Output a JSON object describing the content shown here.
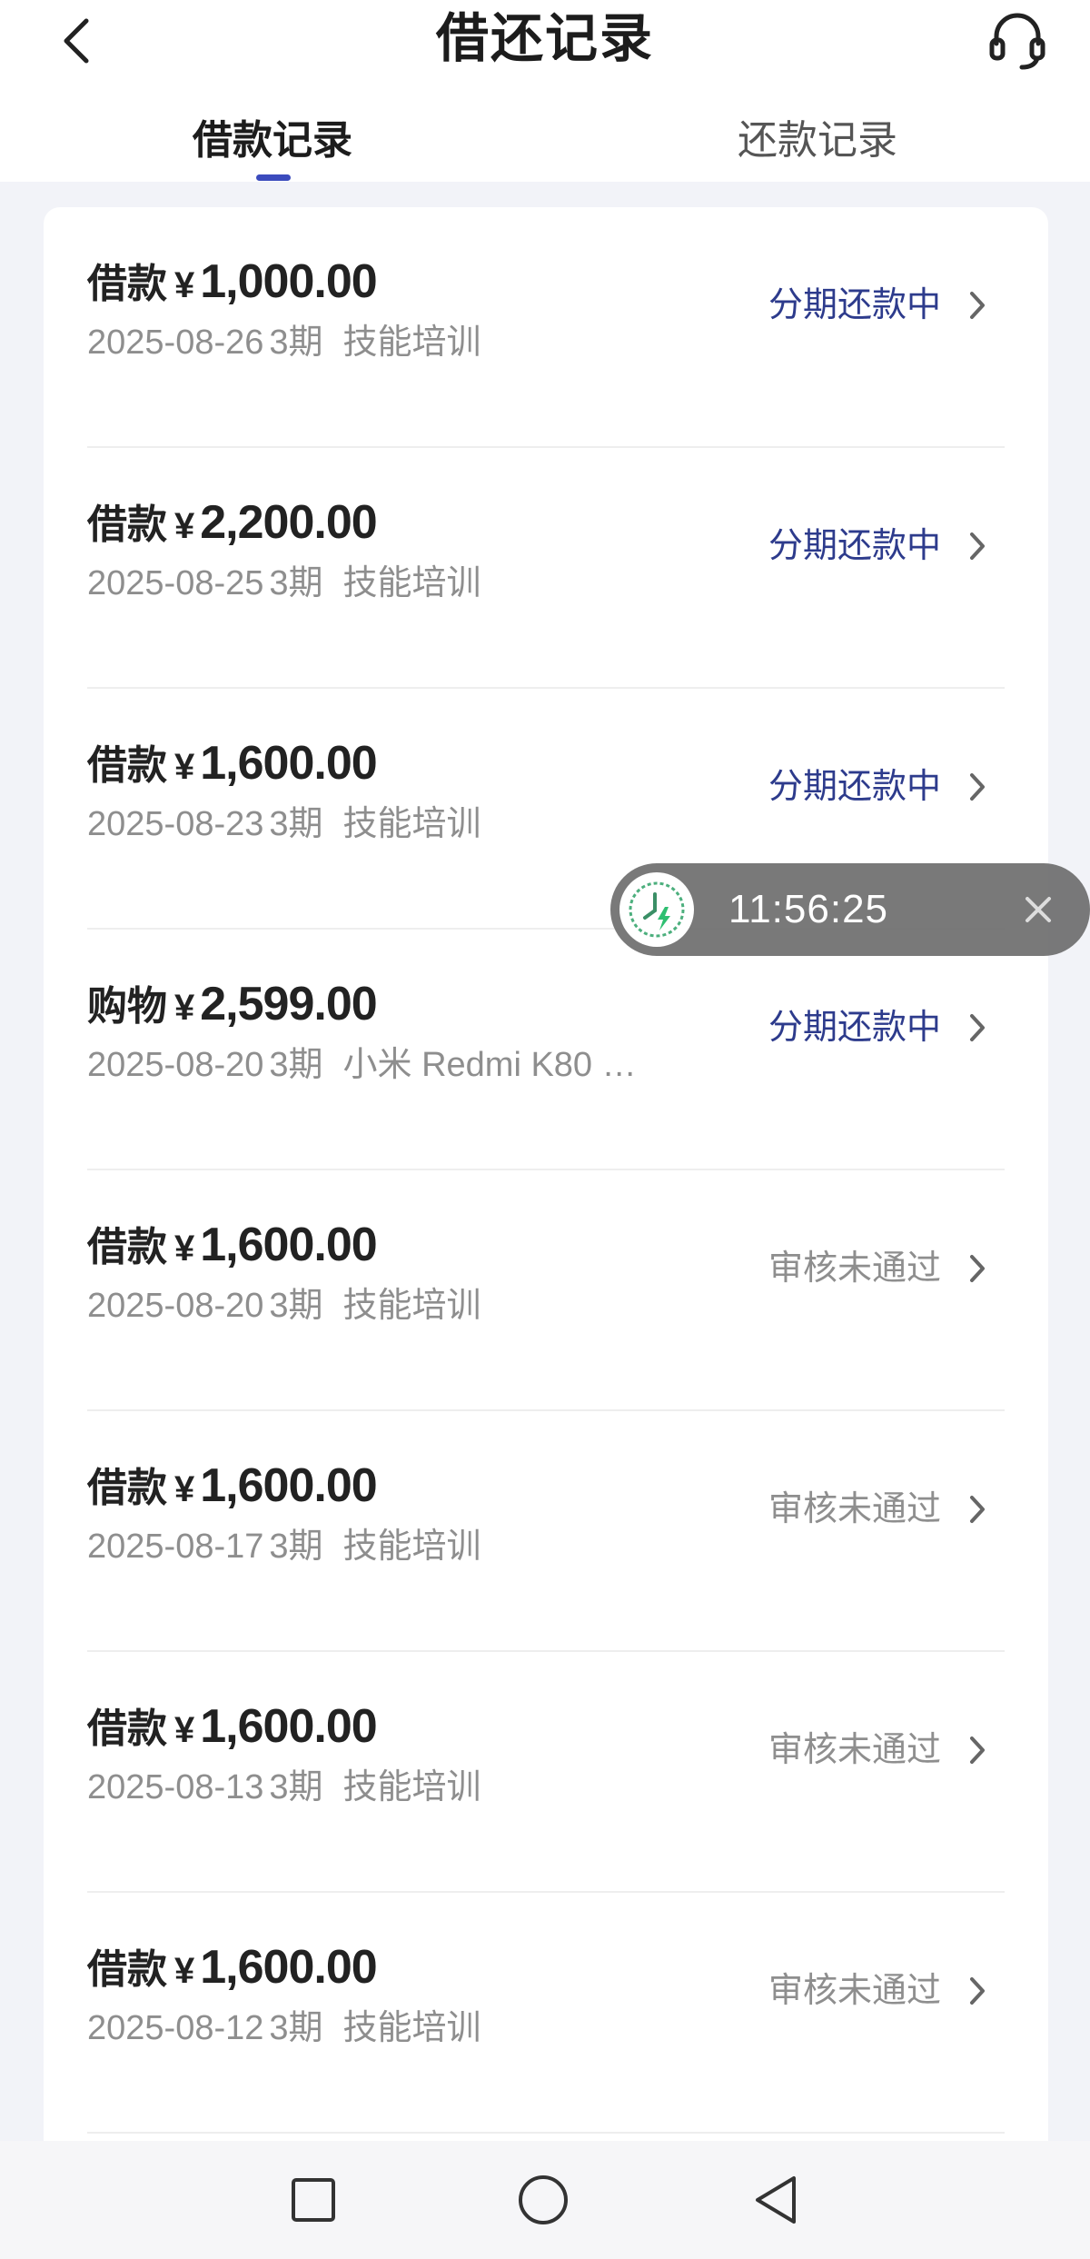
{
  "header": {
    "title": "借还记录",
    "back_icon": "chevron-left-icon",
    "support_icon": "headset-icon"
  },
  "tabs": [
    {
      "label": "借款记录",
      "active": true
    },
    {
      "label": "还款记录",
      "active": false
    }
  ],
  "colors": {
    "accent": "#3b4bbd",
    "status_active": "#2d3b8c",
    "status_rejected": "#8e8e8e",
    "page_bg": "#f2f3f8"
  },
  "records": [
    {
      "kind": "借款",
      "currency": "¥",
      "amount": "1,000.00",
      "date": "2025-08-26",
      "term": "3期",
      "desc": "技能培训",
      "status": "分期还款中",
      "status_type": "active"
    },
    {
      "kind": "借款",
      "currency": "¥",
      "amount": "2,200.00",
      "date": "2025-08-25",
      "term": "3期",
      "desc": "技能培训",
      "status": "分期还款中",
      "status_type": "active"
    },
    {
      "kind": "借款",
      "currency": "¥",
      "amount": "1,600.00",
      "date": "2025-08-23",
      "term": "3期",
      "desc": "技能培训",
      "status": "分期还款中",
      "status_type": "active"
    },
    {
      "kind": "购物",
      "currency": "¥",
      "amount": "2,599.00",
      "date": "2025-08-20",
      "term": "3期",
      "desc": "小米 Redmi K80 至…",
      "status": "分期还款中",
      "status_type": "active"
    },
    {
      "kind": "借款",
      "currency": "¥",
      "amount": "1,600.00",
      "date": "2025-08-20",
      "term": "3期",
      "desc": "技能培训",
      "status": "审核未通过",
      "status_type": "rejected"
    },
    {
      "kind": "借款",
      "currency": "¥",
      "amount": "1,600.00",
      "date": "2025-08-17",
      "term": "3期",
      "desc": "技能培训",
      "status": "审核未通过",
      "status_type": "rejected"
    },
    {
      "kind": "借款",
      "currency": "¥",
      "amount": "1,600.00",
      "date": "2025-08-13",
      "term": "3期",
      "desc": "技能培训",
      "status": "审核未通过",
      "status_type": "rejected"
    },
    {
      "kind": "借款",
      "currency": "¥",
      "amount": "1,600.00",
      "date": "2025-08-12",
      "term": "3期",
      "desc": "技能培训",
      "status": "审核未通过",
      "status_type": "rejected"
    }
  ],
  "floating_timer": {
    "time": "11:56:25",
    "icon": "clock-icon",
    "close_icon": "close-icon"
  },
  "system_nav": {
    "recents_icon": "square-icon",
    "home_icon": "circle-icon",
    "back_icon": "triangle-back-icon"
  }
}
